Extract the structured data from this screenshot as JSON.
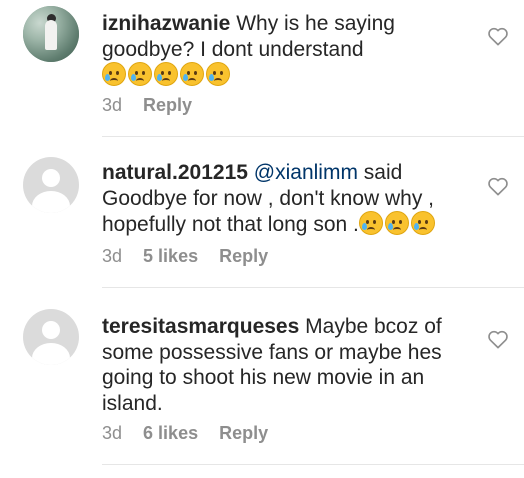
{
  "comments": [
    {
      "username": "iznihazwanie",
      "text": "Why is he saying goodbye? I dont understand",
      "emoji_count": 5,
      "time": "3d",
      "likes": "",
      "reply_label": "Reply"
    },
    {
      "username": "natural.201215",
      "mention": "@xianlimm",
      "text": "said Goodbye for now , don't know why , hopefully not that long  son .",
      "emoji_count": 3,
      "time": "3d",
      "likes": "5 likes",
      "reply_label": "Reply"
    },
    {
      "username": "teresitasmarqueses",
      "text": "Maybe bcoz of some possessive fans or maybe hes going to shoot his new movie in an island.",
      "emoji_count": 0,
      "time": "3d",
      "likes": "6 likes",
      "reply_label": "Reply"
    }
  ],
  "icons": {
    "like": "heart-outline-icon",
    "emoji": "crying-face-emoji"
  },
  "colors": {
    "text": "#262626",
    "meta": "#8e8e8e",
    "mention": "#003569",
    "divider": "#e6e6e6"
  }
}
